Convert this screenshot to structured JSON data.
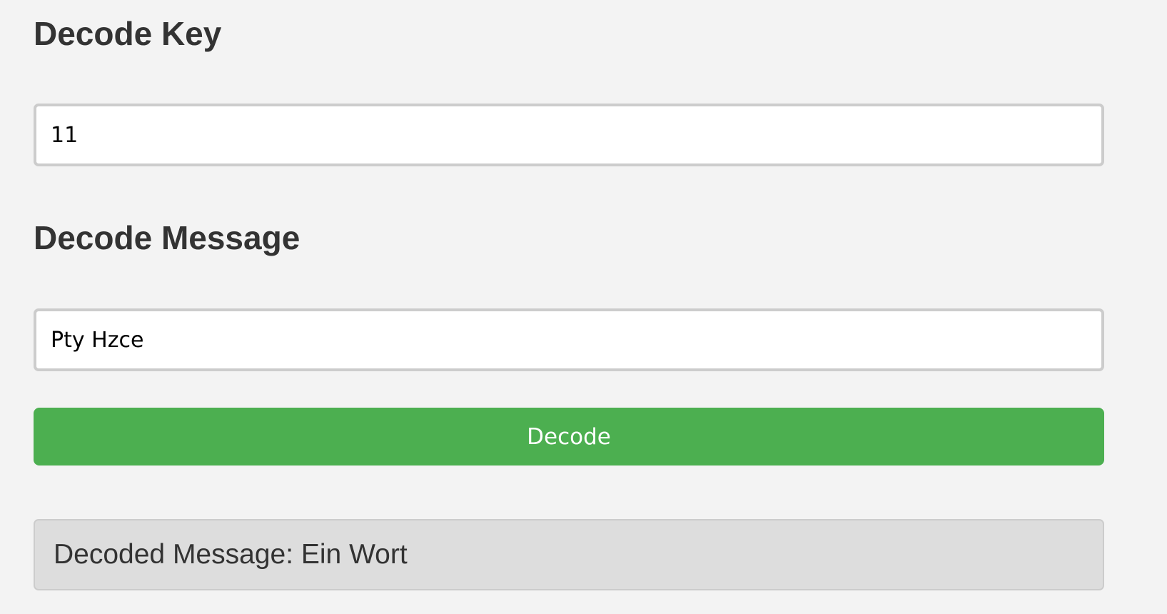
{
  "decode_key": {
    "heading": "Decode Key",
    "value": "11"
  },
  "decode_message": {
    "heading": "Decode Message",
    "value": "Pty Hzce"
  },
  "decode_button": {
    "label": "Decode",
    "color": "#4caf50"
  },
  "result": {
    "label": "Decoded Message: ",
    "value": "Ein Wort"
  },
  "colors": {
    "background": "#f3f3f3",
    "input_border": "#cccccc",
    "result_background": "#dddddd",
    "text": "#333333"
  }
}
